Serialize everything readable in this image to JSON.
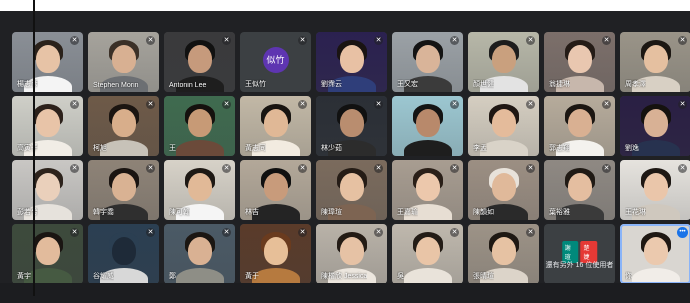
{
  "meeting": {
    "mic_glyph": "🎙",
    "speaking_glyph": "|||",
    "muted_icon": "mic-off-icon",
    "accent": "#8ab4f8"
  },
  "participants": [
    {
      "name": "楊志彥",
      "bg": "#8a8f96",
      "skin": "#e7c3a6",
      "hair": "#2a211a",
      "shirt": "#f4f4f4"
    },
    {
      "name": "Stephen Morin",
      "bg": "#a6a39c",
      "skin": "#d8b092",
      "hair": "#3b3027",
      "shirt": "#6c6f73"
    },
    {
      "name": "Antonin Lee",
      "bg": "#3a3a3c",
      "skin": "#c69a7c",
      "hair": "#111",
      "shirt": "#1e1e1e"
    },
    {
      "name": "王似竹",
      "avatar": "似竹",
      "avatar_color": "#5e35b1"
    },
    {
      "name": "劉霈云",
      "bg": "#2b2150",
      "skin": "#e8c1a4",
      "hair": "#1a1412",
      "shirt": "#2f3e7a"
    },
    {
      "name": "王又宏",
      "bg": "#9ba1a6",
      "skin": "#d9b499",
      "hair": "#141414",
      "shirt": "#3b3b3b"
    },
    {
      "name": "顏世健",
      "bg": "#b7b7a8",
      "skin": "#c9a07e",
      "hair": "#1d1d1d",
      "shirt": "#e3e3e3"
    },
    {
      "name": "翁捷琳",
      "bg": "#7c6f6a",
      "skin": "#e9c7b0",
      "hair": "#241b16",
      "shirt": "#c7b7ac"
    },
    {
      "name": "周孝澤",
      "bg": "#9a9488",
      "skin": "#e5c0a0",
      "hair": "#1c1712",
      "shirt": "#d8d0c4"
    },
    {
      "name": "高寅子",
      "bg": "#cfcfc8",
      "skin": "#e8c4a8",
      "hair": "#2c211b",
      "shirt": "#f1ede6"
    },
    {
      "name": "柯旭",
      "bg": "#6e5a48",
      "skin": "#d8ae8b",
      "hair": "#1b1511",
      "shirt": "#c7c2b8"
    },
    {
      "name": "王",
      "bg": "#3f6b4f",
      "skin": "#c79a76",
      "hair": "#15110e",
      "shirt": "#6b4a3a"
    },
    {
      "name": "黃志同",
      "bg": "#c2b8a6",
      "skin": "#e0b896",
      "hair": "#181410",
      "shirt": "#f2ebe0"
    },
    {
      "name": "林少茹",
      "bg": "#2b2f36",
      "skin": "#b98d6f",
      "hair": "#111",
      "shirt": "#2c2c2c"
    },
    {
      "name": "",
      "bg": "#9cc7d1",
      "skin": "#b8896b",
      "hair": "#141414",
      "shirt": "#1e1e1e"
    },
    {
      "name": "李孟",
      "bg": "#d5cec1",
      "skin": "#e4bb9b",
      "hair": "#1f1713",
      "shirt": "#d9d3c8"
    },
    {
      "name": "郭志翔",
      "bg": "#b6ab9b",
      "skin": "#d9b092",
      "hair": "#1b1612",
      "shirt": "#f4f2ee"
    },
    {
      "name": "劉逸",
      "bg": "#2a1f44",
      "skin": "#d8b195",
      "hair": "#15120f",
      "shirt": "#27324f"
    },
    {
      "name": "彭若兮",
      "bg": "#c9c7c4",
      "skin": "#ead0bb",
      "hair": "#2d231c",
      "shirt": "#e6e2dc"
    },
    {
      "name": "韓宇喬",
      "bg": "#8e8377",
      "skin": "#d9b293",
      "hair": "#1a1411",
      "shirt": "#2f2f2f"
    },
    {
      "name": "陳可翰",
      "bg": "#d7d2c8",
      "skin": "#e1b997",
      "hair": "#1e1914",
      "shirt": "#f5f5f5"
    },
    {
      "name": "林吉",
      "bg": "#b3a899",
      "skin": "#c89b7b",
      "hair": "#101010",
      "shirt": "#242424"
    },
    {
      "name": "陳瑋瑄",
      "bg": "#7b6b5d",
      "skin": "#e6c1a2",
      "hair": "#251c16",
      "shirt": "#7d6452"
    },
    {
      "name": "王嘉瑜",
      "bg": "#a89d91",
      "skin": "#ecc8ac",
      "hair": "#2a1f18",
      "shirt": "#e7ded3"
    },
    {
      "name": "陳韻如",
      "bg": "#9c8f83",
      "skin": "#e0b99a",
      "hair": "#e8e2da",
      "shirt": "#2a2a2a"
    },
    {
      "name": "葉裕雅",
      "bg": "#8f8983",
      "skin": "#e4bea0",
      "hair": "#201a15",
      "shirt": "#3a3a3a"
    },
    {
      "name": "王花琳",
      "bg": "#e6e3de",
      "skin": "#eac6aa",
      "hair": "#1d1713",
      "shirt": "#cfc8be"
    },
    {
      "name": "黃宇",
      "bg": "#3d4a3c",
      "skin": "#e2bb9c",
      "hair": "#1a1512",
      "shirt": "#465a42"
    },
    {
      "name": "谷耀威",
      "bg": "#2b3f52",
      "skin": "#1e2a38",
      "hair": "#2b3f52",
      "shirt": "#d8d8d8"
    },
    {
      "name": "鄭",
      "bg": "#4b5a66",
      "skin": "#d9b193",
      "hair": "#1b1612",
      "shirt": "#8e8e86"
    },
    {
      "name": "黃于",
      "bg": "#5a3b2a",
      "skin": "#e7bf98",
      "hair": "#6a3b1e",
      "shirt": "#b67a3f"
    },
    {
      "name": "陳楷欣 Jessica",
      "bg": "#b9b2a8",
      "skin": "#e6c2a5",
      "hair": "#231b15",
      "shirt": "#ece6de"
    },
    {
      "name": "吳",
      "bg": "#bfb8ad",
      "skin": "#e9c5a7",
      "hair": "#231c16",
      "shirt": "#e9e3da"
    },
    {
      "name": "張晴瑄",
      "bg": "#9d9387",
      "skin": "#e6c2a3",
      "hair": "#1e1813",
      "shirt": "#dcd4c9"
    }
  ],
  "others_tile": {
    "avatars": [
      "謝瑄",
      "楚婕"
    ],
    "avatar_colors": [
      "#00897b",
      "#e53935"
    ],
    "label": "還有另外 16 位使用者"
  },
  "self_tile": {
    "name": "你",
    "bg": "#d9d6d1",
    "skin": "#ebc9ae",
    "hair": "#1f1813",
    "shirt": "#f1ede8"
  }
}
